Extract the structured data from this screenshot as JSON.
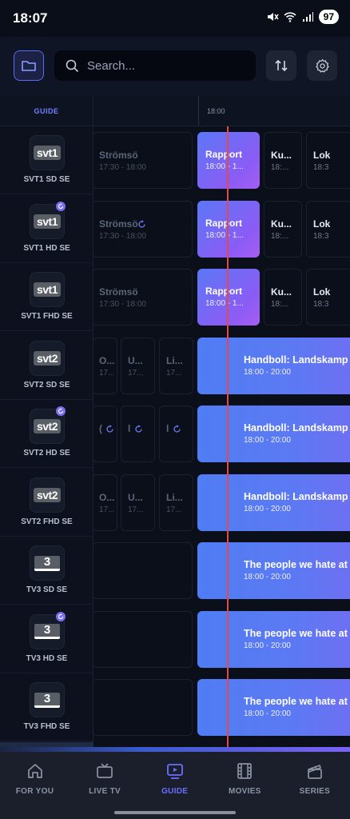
{
  "status": {
    "time": "18:07",
    "battery": "97"
  },
  "search": {
    "placeholder": "Search..."
  },
  "guide": {
    "tab_label": "GUIDE",
    "time_label": "18:00",
    "channels": [
      {
        "name": "SVT1 SD SE",
        "logo": "svt1",
        "catchup": false
      },
      {
        "name": "SVT1 HD SE",
        "logo": "svt1",
        "catchup": true
      },
      {
        "name": "SVT1 FHD SE",
        "logo": "svt1",
        "catchup": false
      },
      {
        "name": "SVT2 SD SE",
        "logo": "svt2",
        "catchup": false
      },
      {
        "name": "SVT2 HD SE",
        "logo": "svt2",
        "catchup": true
      },
      {
        "name": "SVT2 FHD SE",
        "logo": "svt2",
        "catchup": false
      },
      {
        "name": "TV3 SD SE",
        "logo": "3",
        "catchup": false
      },
      {
        "name": "TV3 HD SE",
        "logo": "3",
        "catchup": true
      },
      {
        "name": "TV3 FHD SE",
        "logo": "3",
        "catchup": false
      }
    ],
    "rows": [
      [
        {
          "title": "Strömsö",
          "time": "17:30 - 18:00",
          "kind": "faded"
        },
        {
          "title": "Rapport",
          "time": "18:00 - 1...",
          "kind": "live"
        },
        {
          "title": "Ku...",
          "time": "18:...",
          "kind": "normal"
        },
        {
          "title": "Lok",
          "time": "18:3",
          "kind": "normal"
        }
      ],
      [
        {
          "title": "Strömsö",
          "time": "17:30 - 18:00",
          "kind": "faded",
          "catchup": true
        },
        {
          "title": "Rapport",
          "time": "18:00 - 1...",
          "kind": "live"
        },
        {
          "title": "Ku...",
          "time": "18:...",
          "kind": "normal"
        },
        {
          "title": "Lok",
          "time": "18:3",
          "kind": "normal"
        }
      ],
      [
        {
          "title": "Strömsö",
          "time": "17:30 - 18:00",
          "kind": "faded"
        },
        {
          "title": "Rapport",
          "time": "18:00 - 1...",
          "kind": "live"
        },
        {
          "title": "Ku...",
          "time": "18:...",
          "kind": "normal"
        },
        {
          "title": "Lok",
          "time": "18:3",
          "kind": "normal"
        }
      ],
      [
        {
          "title": "O...",
          "time": "17...",
          "kind": "faded"
        },
        {
          "title": "U...",
          "time": "17...",
          "kind": "faded"
        },
        {
          "title": "Li...",
          "time": "17...",
          "kind": "faded"
        },
        {
          "title": "Handboll: Landskamp",
          "time": "18:00 - 20:00",
          "kind": "blue"
        }
      ],
      [
        {
          "title": "(",
          "time": "",
          "kind": "faded",
          "catchup": true
        },
        {
          "title": "l",
          "time": "",
          "kind": "faded",
          "catchup": true
        },
        {
          "title": "l",
          "time": "",
          "kind": "faded",
          "catchup": true
        },
        {
          "title": "Handboll: Landskamp",
          "time": "18:00 - 20:00",
          "kind": "blue"
        }
      ],
      [
        {
          "title": "O...",
          "time": "17...",
          "kind": "faded"
        },
        {
          "title": "U...",
          "time": "17...",
          "kind": "faded"
        },
        {
          "title": "Li...",
          "time": "17...",
          "kind": "faded"
        },
        {
          "title": "Handboll: Landskamp",
          "time": "18:00 - 20:00",
          "kind": "blue"
        }
      ],
      [
        {
          "title": "",
          "time": "",
          "kind": "faded"
        },
        {
          "title": "The people we hate at t",
          "time": "18:00 - 20:00",
          "kind": "blue"
        }
      ],
      [
        {
          "title": "",
          "time": "",
          "kind": "faded"
        },
        {
          "title": "The people we hate at t",
          "time": "18:00 - 20:00",
          "kind": "blue"
        }
      ],
      [
        {
          "title": "",
          "time": "",
          "kind": "faded"
        },
        {
          "title": "The people we hate at t",
          "time": "18:00 - 20:00",
          "kind": "blue"
        }
      ]
    ]
  },
  "nav": {
    "items": [
      {
        "label": "FOR YOU",
        "icon": "home-icon",
        "active": false
      },
      {
        "label": "LIVE TV",
        "icon": "tv-icon",
        "active": false
      },
      {
        "label": "GUIDE",
        "icon": "guide-icon",
        "active": true
      },
      {
        "label": "MOVIES",
        "icon": "film-icon",
        "active": false
      },
      {
        "label": "SERIES",
        "icon": "clapper-icon",
        "active": false
      }
    ]
  },
  "colors": {
    "accent": "#6b6dff",
    "now_line": "#e0494f",
    "live_start": "#5b78f6",
    "live_end": "#a55ef3"
  }
}
